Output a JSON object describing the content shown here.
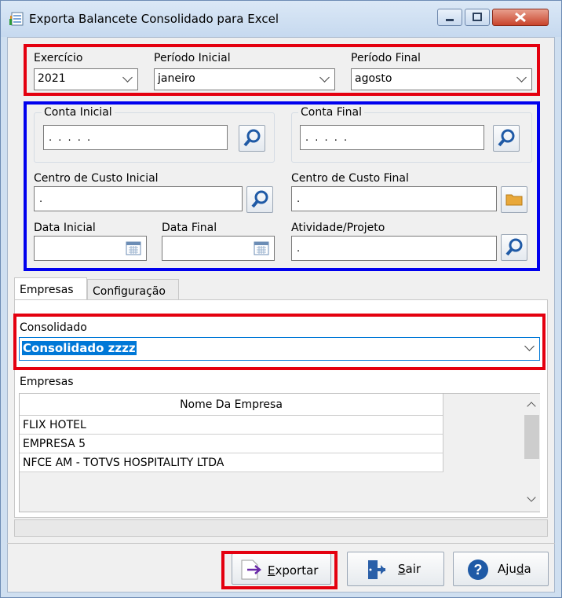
{
  "window": {
    "title": "Exporta Balancete Consolidado para Excel"
  },
  "period": {
    "exercicio_label": "Exercício",
    "exercicio_value": "2021",
    "inicial_label": "Período Inicial",
    "inicial_value": "janeiro",
    "final_label": "Período Final",
    "final_value": "agosto"
  },
  "filters": {
    "conta_inicial_label": "Conta Inicial",
    "conta_inicial_value": ". . . . .",
    "conta_final_label": "Conta Final",
    "conta_final_value": ". . . . .",
    "cc_inicial_label": "Centro de Custo Inicial",
    "cc_inicial_value": ".",
    "cc_final_label": "Centro de Custo Final",
    "cc_final_value": ".",
    "data_inicial_label": "Data Inicial",
    "data_inicial_value": "",
    "data_final_label": "Data Final",
    "data_final_value": "",
    "atividade_label": "Atividade/Projeto",
    "atividade_value": "."
  },
  "tabs": [
    "Empresas",
    "Configuração"
  ],
  "consolidado": {
    "label": "Consolidado",
    "value": "Consolidado zzzz"
  },
  "empresas": {
    "label": "Empresas",
    "column": "Nome Da Empresa",
    "rows": [
      "FLIX HOTEL",
      "EMPRESA 5",
      "NFCE AM - TOTVS HOSPITALITY LTDA"
    ]
  },
  "buttons": {
    "exportar_u": "E",
    "exportar_rest": "xportar",
    "sair_u": "S",
    "sair_rest": "air",
    "ajuda_pre": "Aju",
    "ajuda_u": "d",
    "ajuda_post": "a"
  },
  "colors": {
    "highlight_red": "#e4000f",
    "highlight_blue": "#0000ee",
    "selection": "#0078d7"
  }
}
